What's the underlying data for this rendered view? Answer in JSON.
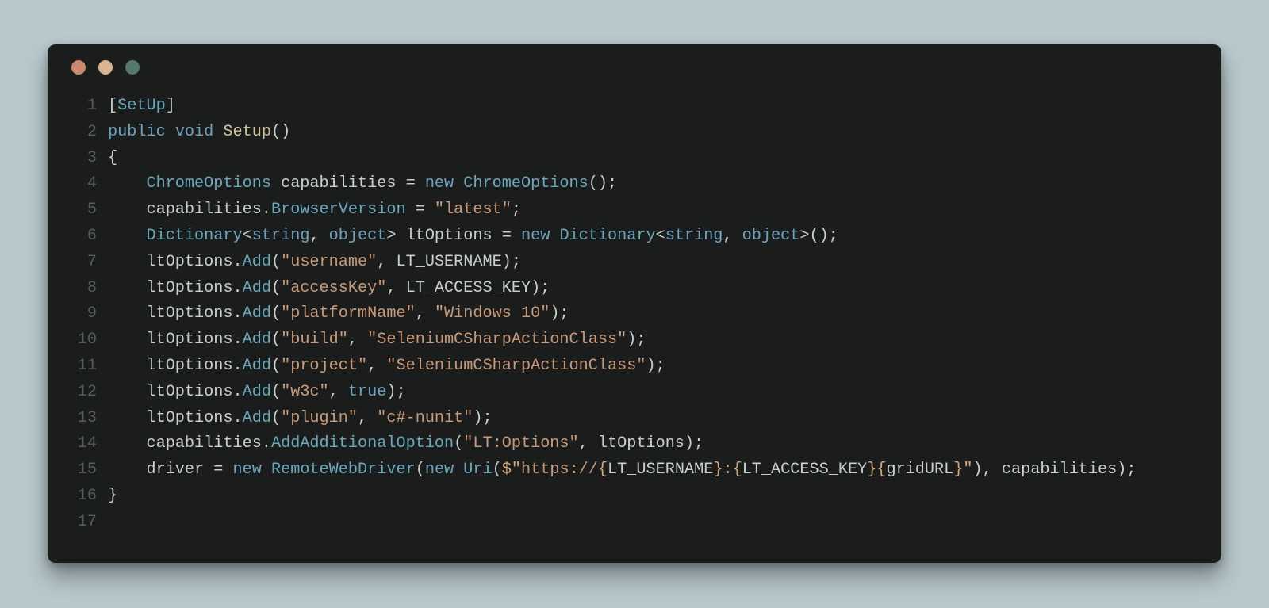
{
  "window": {
    "traffic": {
      "close": "close",
      "minimize": "minimize",
      "zoom": "zoom"
    }
  },
  "code": {
    "indent_unit": "    ",
    "lines": [
      {
        "n": "1",
        "indent": 0,
        "tokens": [
          {
            "cls": "punct",
            "key": "l1_lb",
            "txt": "["
          },
          {
            "cls": "type",
            "key": "l1_setup",
            "txt": "SetUp"
          },
          {
            "cls": "punct",
            "key": "l1_rb",
            "txt": "]"
          }
        ]
      },
      {
        "n": "2",
        "indent": 0,
        "tokens": [
          {
            "cls": "kw",
            "key": "l2_public",
            "txt": "public "
          },
          {
            "cls": "kw",
            "key": "l2_void",
            "txt": "void "
          },
          {
            "cls": "method",
            "key": "l2_name",
            "txt": "Setup"
          },
          {
            "cls": "punct",
            "key": "l2_paren",
            "txt": "()"
          }
        ]
      },
      {
        "n": "3",
        "indent": 0,
        "tokens": [
          {
            "cls": "punct",
            "key": "l3_open",
            "txt": "{"
          }
        ]
      },
      {
        "n": "4",
        "indent": 1,
        "tokens": [
          {
            "cls": "type",
            "key": "l4_t1",
            "txt": "ChromeOptions "
          },
          {
            "cls": "ident",
            "key": "l4_v",
            "txt": "capabilities "
          },
          {
            "cls": "punct",
            "key": "l4_eq",
            "txt": "= "
          },
          {
            "cls": "kw",
            "key": "l4_new",
            "txt": "new "
          },
          {
            "cls": "type",
            "key": "l4_t2",
            "txt": "ChromeOptions"
          },
          {
            "cls": "punct",
            "key": "l4_e",
            "txt": "();"
          }
        ]
      },
      {
        "n": "5",
        "indent": 1,
        "tokens": [
          {
            "cls": "ident",
            "key": "l5_c",
            "txt": "capabilities"
          },
          {
            "cls": "punct",
            "key": "l5_d",
            "txt": "."
          },
          {
            "cls": "type",
            "key": "l5_bv",
            "txt": "BrowserVersion "
          },
          {
            "cls": "punct",
            "key": "l5_eq",
            "txt": "= "
          },
          {
            "cls": "str",
            "key": "l5_s",
            "txt": "\"latest\""
          },
          {
            "cls": "punct",
            "key": "l5_sc",
            "txt": ";"
          }
        ]
      },
      {
        "n": "6",
        "indent": 1,
        "tokens": [
          {
            "cls": "type",
            "key": "l6_dict",
            "txt": "Dictionary"
          },
          {
            "cls": "punct",
            "key": "l6_lt",
            "txt": "<"
          },
          {
            "cls": "kw",
            "key": "l6_str",
            "txt": "string"
          },
          {
            "cls": "punct",
            "key": "l6_c1",
            "txt": ", "
          },
          {
            "cls": "kw",
            "key": "l6_obj",
            "txt": "object"
          },
          {
            "cls": "punct",
            "key": "l6_gt",
            "txt": "> "
          },
          {
            "cls": "ident",
            "key": "l6_v",
            "txt": "ltOptions "
          },
          {
            "cls": "punct",
            "key": "l6_eq",
            "txt": "= "
          },
          {
            "cls": "kw",
            "key": "l6_new",
            "txt": "new "
          },
          {
            "cls": "type",
            "key": "l6_d2",
            "txt": "Dictionary"
          },
          {
            "cls": "punct",
            "key": "l6_lt2",
            "txt": "<"
          },
          {
            "cls": "kw",
            "key": "l6_str2",
            "txt": "string"
          },
          {
            "cls": "punct",
            "key": "l6_c2",
            "txt": ", "
          },
          {
            "cls": "kw",
            "key": "l6_obj2",
            "txt": "object"
          },
          {
            "cls": "punct",
            "key": "l6_end",
            "txt": ">();"
          }
        ]
      },
      {
        "n": "7",
        "indent": 1,
        "tokens": [
          {
            "cls": "ident",
            "key": "l7_v",
            "txt": "ltOptions"
          },
          {
            "cls": "punct",
            "key": "l7_d",
            "txt": "."
          },
          {
            "cls": "type",
            "key": "l7_a",
            "txt": "Add"
          },
          {
            "cls": "punct",
            "key": "l7_o",
            "txt": "("
          },
          {
            "cls": "str",
            "key": "l7_s",
            "txt": "\"username\""
          },
          {
            "cls": "punct",
            "key": "l7_c",
            "txt": ", "
          },
          {
            "cls": "const",
            "key": "l7_k",
            "txt": "LT_USERNAME"
          },
          {
            "cls": "punct",
            "key": "l7_e",
            "txt": ");"
          }
        ]
      },
      {
        "n": "8",
        "indent": 1,
        "tokens": [
          {
            "cls": "ident",
            "key": "l8_v",
            "txt": "ltOptions"
          },
          {
            "cls": "punct",
            "key": "l8_d",
            "txt": "."
          },
          {
            "cls": "type",
            "key": "l8_a",
            "txt": "Add"
          },
          {
            "cls": "punct",
            "key": "l8_o",
            "txt": "("
          },
          {
            "cls": "str",
            "key": "l8_s",
            "txt": "\"accessKey\""
          },
          {
            "cls": "punct",
            "key": "l8_c",
            "txt": ", "
          },
          {
            "cls": "const",
            "key": "l8_k",
            "txt": "LT_ACCESS_KEY"
          },
          {
            "cls": "punct",
            "key": "l8_e",
            "txt": ");"
          }
        ]
      },
      {
        "n": "9",
        "indent": 1,
        "tokens": [
          {
            "cls": "ident",
            "key": "l9_v",
            "txt": "ltOptions"
          },
          {
            "cls": "punct",
            "key": "l9_d",
            "txt": "."
          },
          {
            "cls": "type",
            "key": "l9_a",
            "txt": "Add"
          },
          {
            "cls": "punct",
            "key": "l9_o",
            "txt": "("
          },
          {
            "cls": "str",
            "key": "l9_s1",
            "txt": "\"platformName\""
          },
          {
            "cls": "punct",
            "key": "l9_c",
            "txt": ", "
          },
          {
            "cls": "str",
            "key": "l9_s2",
            "txt": "\"Windows 10\""
          },
          {
            "cls": "punct",
            "key": "l9_e",
            "txt": ");"
          }
        ]
      },
      {
        "n": "10",
        "indent": 1,
        "tokens": [
          {
            "cls": "ident",
            "key": "l10_v",
            "txt": "ltOptions"
          },
          {
            "cls": "punct",
            "key": "l10_d",
            "txt": "."
          },
          {
            "cls": "type",
            "key": "l10_a",
            "txt": "Add"
          },
          {
            "cls": "punct",
            "key": "l10_o",
            "txt": "("
          },
          {
            "cls": "str",
            "key": "l10_s1",
            "txt": "\"build\""
          },
          {
            "cls": "punct",
            "key": "l10_c",
            "txt": ", "
          },
          {
            "cls": "str",
            "key": "l10_s2",
            "txt": "\"SeleniumCSharpActionClass\""
          },
          {
            "cls": "punct",
            "key": "l10_e",
            "txt": ");"
          }
        ]
      },
      {
        "n": "11",
        "indent": 1,
        "tokens": [
          {
            "cls": "ident",
            "key": "l11_v",
            "txt": "ltOptions"
          },
          {
            "cls": "punct",
            "key": "l11_d",
            "txt": "."
          },
          {
            "cls": "type",
            "key": "l11_a",
            "txt": "Add"
          },
          {
            "cls": "punct",
            "key": "l11_o",
            "txt": "("
          },
          {
            "cls": "str",
            "key": "l11_s1",
            "txt": "\"project\""
          },
          {
            "cls": "punct",
            "key": "l11_c",
            "txt": ", "
          },
          {
            "cls": "str",
            "key": "l11_s2",
            "txt": "\"SeleniumCSharpActionClass\""
          },
          {
            "cls": "punct",
            "key": "l11_e",
            "txt": ");"
          }
        ]
      },
      {
        "n": "12",
        "indent": 1,
        "tokens": [
          {
            "cls": "ident",
            "key": "l12_v",
            "txt": "ltOptions"
          },
          {
            "cls": "punct",
            "key": "l12_d",
            "txt": "."
          },
          {
            "cls": "type",
            "key": "l12_a",
            "txt": "Add"
          },
          {
            "cls": "punct",
            "key": "l12_o",
            "txt": "("
          },
          {
            "cls": "str",
            "key": "l12_s",
            "txt": "\"w3c\""
          },
          {
            "cls": "punct",
            "key": "l12_c",
            "txt": ", "
          },
          {
            "cls": "kw",
            "key": "l12_t",
            "txt": "true"
          },
          {
            "cls": "punct",
            "key": "l12_e",
            "txt": ");"
          }
        ]
      },
      {
        "n": "13",
        "indent": 1,
        "tokens": [
          {
            "cls": "ident",
            "key": "l13_v",
            "txt": "ltOptions"
          },
          {
            "cls": "punct",
            "key": "l13_d",
            "txt": "."
          },
          {
            "cls": "type",
            "key": "l13_a",
            "txt": "Add"
          },
          {
            "cls": "punct",
            "key": "l13_o",
            "txt": "("
          },
          {
            "cls": "str",
            "key": "l13_s1",
            "txt": "\"plugin\""
          },
          {
            "cls": "punct",
            "key": "l13_c",
            "txt": ", "
          },
          {
            "cls": "str",
            "key": "l13_s2",
            "txt": "\"c#-nunit\""
          },
          {
            "cls": "punct",
            "key": "l13_e",
            "txt": ");"
          }
        ]
      },
      {
        "n": "14",
        "indent": 1,
        "tokens": [
          {
            "cls": "ident",
            "key": "l14_c",
            "txt": "capabilities"
          },
          {
            "cls": "punct",
            "key": "l14_d",
            "txt": "."
          },
          {
            "cls": "type",
            "key": "l14_a",
            "txt": "AddAdditionalOption"
          },
          {
            "cls": "punct",
            "key": "l14_o",
            "txt": "("
          },
          {
            "cls": "str",
            "key": "l14_s",
            "txt": "\"LT:Options\""
          },
          {
            "cls": "punct",
            "key": "l14_cm",
            "txt": ", "
          },
          {
            "cls": "ident",
            "key": "l14_l",
            "txt": "ltOptions"
          },
          {
            "cls": "punct",
            "key": "l14_e",
            "txt": ");"
          }
        ]
      },
      {
        "n": "15",
        "indent": 1,
        "tokens": [
          {
            "cls": "ident",
            "key": "l15_drv",
            "txt": "driver "
          },
          {
            "cls": "punct",
            "key": "l15_eq",
            "txt": "= "
          },
          {
            "cls": "kw",
            "key": "l15_new",
            "txt": "new "
          },
          {
            "cls": "type",
            "key": "l15_rwd",
            "txt": "RemoteWebDriver"
          },
          {
            "cls": "punct",
            "key": "l15_o1",
            "txt": "("
          },
          {
            "cls": "kw",
            "key": "l15_new2",
            "txt": "new "
          },
          {
            "cls": "type",
            "key": "l15_uri",
            "txt": "Uri"
          },
          {
            "cls": "punct",
            "key": "l15_o2",
            "txt": "("
          },
          {
            "cls": "orange",
            "key": "l15_do",
            "txt": "$\""
          },
          {
            "cls": "str",
            "key": "l15_p1",
            "txt": "https://"
          },
          {
            "cls": "orange",
            "key": "l15_b1o",
            "txt": "{"
          },
          {
            "cls": "const",
            "key": "l15_u",
            "txt": "LT_USERNAME"
          },
          {
            "cls": "orange",
            "key": "l15_b1c",
            "txt": "}"
          },
          {
            "cls": "str",
            "key": "l15_col",
            "txt": ":"
          },
          {
            "cls": "orange",
            "key": "l15_b2o",
            "txt": "{"
          },
          {
            "cls": "const",
            "key": "l15_ak",
            "txt": "LT_ACCESS_KEY"
          },
          {
            "cls": "orange",
            "key": "l15_b2c",
            "txt": "}"
          },
          {
            "cls": "orange",
            "key": "l15_b3o",
            "txt": "{"
          },
          {
            "cls": "const",
            "key": "l15_gu",
            "txt": "gridURL"
          },
          {
            "cls": "orange",
            "key": "l15_b3c",
            "txt": "}"
          },
          {
            "cls": "orange",
            "key": "l15_dc",
            "txt": "\""
          },
          {
            "cls": "punct",
            "key": "l15_c1",
            "txt": ")"
          },
          {
            "cls": "punct",
            "key": "l15_cm",
            "txt": ", "
          },
          {
            "cls": "ident",
            "key": "l15_cap",
            "txt": "capabilities"
          },
          {
            "cls": "punct",
            "key": "l15_e",
            "txt": ");"
          }
        ]
      },
      {
        "n": "16",
        "indent": 0,
        "tokens": [
          {
            "cls": "punct",
            "key": "l16_close",
            "txt": "}"
          }
        ]
      },
      {
        "n": "17",
        "indent": 0,
        "tokens": []
      }
    ]
  }
}
